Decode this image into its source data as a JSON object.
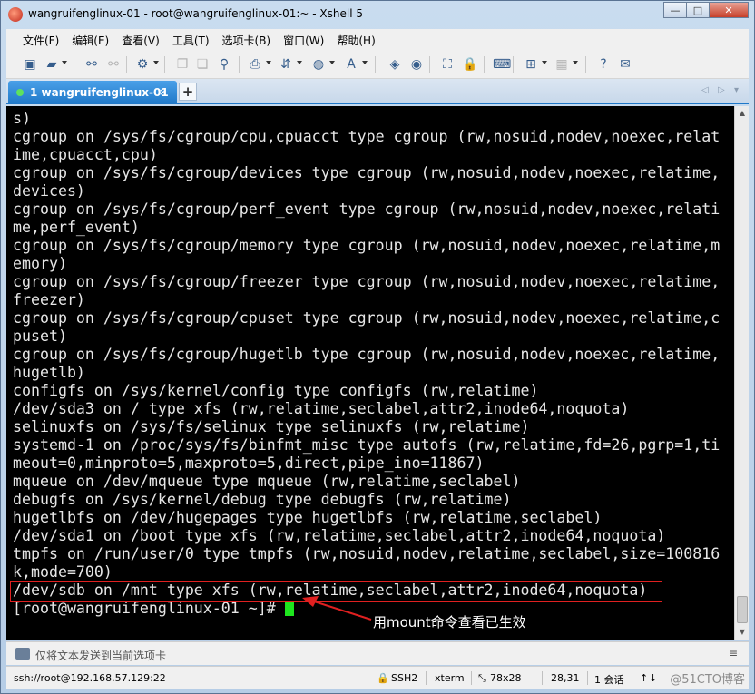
{
  "window": {
    "title": "wangruifenglinux-01 - root@wangruifenglinux-01:~ - Xshell 5",
    "controls": [
      "—",
      "□",
      "✕"
    ]
  },
  "menu": [
    "文件(F)",
    "编辑(E)",
    "查看(V)",
    "工具(T)",
    "选项卡(B)",
    "窗口(W)",
    "帮助(H)"
  ],
  "tabs": {
    "active": {
      "number": "1",
      "label": "wangruifenglinux-01",
      "close": "×"
    },
    "add_label": "+",
    "nav_left": "◁",
    "nav_right": "▷",
    "nav_menu": "▾"
  },
  "terminal": {
    "lines": [
      "s)",
      "cgroup on /sys/fs/cgroup/cpu,cpuacct type cgroup (rw,nosuid,nodev,noexec,relat",
      "ime,cpuacct,cpu)",
      "cgroup on /sys/fs/cgroup/devices type cgroup (rw,nosuid,nodev,noexec,relatime,",
      "devices)",
      "cgroup on /sys/fs/cgroup/perf_event type cgroup (rw,nosuid,nodev,noexec,relati",
      "me,perf_event)",
      "cgroup on /sys/fs/cgroup/memory type cgroup (rw,nosuid,nodev,noexec,relatime,m",
      "emory)",
      "cgroup on /sys/fs/cgroup/freezer type cgroup (rw,nosuid,nodev,noexec,relatime,",
      "freezer)",
      "cgroup on /sys/fs/cgroup/cpuset type cgroup (rw,nosuid,nodev,noexec,relatime,c",
      "puset)",
      "cgroup on /sys/fs/cgroup/hugetlb type cgroup (rw,nosuid,nodev,noexec,relatime,",
      "hugetlb)",
      "configfs on /sys/kernel/config type configfs (rw,relatime)",
      "/dev/sda3 on / type xfs (rw,relatime,seclabel,attr2,inode64,noquota)",
      "selinuxfs on /sys/fs/selinux type selinuxfs (rw,relatime)",
      "systemd-1 on /proc/sys/fs/binfmt_misc type autofs (rw,relatime,fd=26,pgrp=1,ti",
      "meout=0,minproto=5,maxproto=5,direct,pipe_ino=11867)",
      "mqueue on /dev/mqueue type mqueue (rw,relatime,seclabel)",
      "debugfs on /sys/kernel/debug type debugfs (rw,relatime)",
      "hugetlbfs on /dev/hugepages type hugetlbfs (rw,relatime,seclabel)",
      "/dev/sda1 on /boot type xfs (rw,relatime,seclabel,attr2,inode64,noquota)",
      "tmpfs on /run/user/0 type tmpfs (rw,nosuid,nodev,relatime,seclabel,size=100816",
      "k,mode=700)",
      "/dev/sdb on /mnt type xfs (rw,relatime,seclabel,attr2,inode64,noquota)"
    ],
    "prompt": "[root@wangruifenglinux-01 ~]# ",
    "annotation": "用mount命令查看已生效"
  },
  "sendbar": {
    "placeholder": "仅将文本发送到当前选项卡",
    "menu": "≡"
  },
  "status": {
    "connection": "ssh://root@192.168.57.129:22",
    "protocol": "SSH2",
    "terminal_type": "xterm",
    "size": "78x28",
    "cursor": "28,31",
    "sessions": "1 会话",
    "watermark": "@51CTO博客"
  },
  "colors": {
    "tab_active": "#1f78c8",
    "terminal_bg": "#000000",
    "terminal_fg": "#e6e6e6",
    "cursor": "#1ee61e",
    "highlight": "#e02020"
  }
}
